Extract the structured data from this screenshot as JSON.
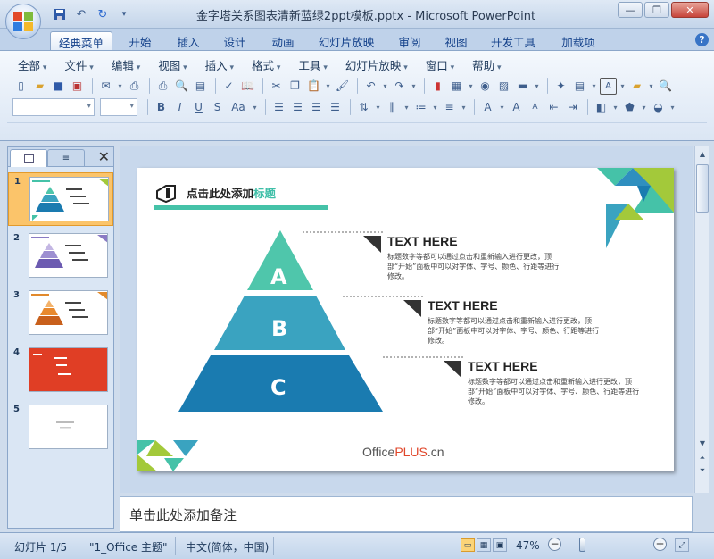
{
  "window": {
    "title": "金字塔关系图表清新蓝绿2ppt模板.pptx - Microsoft PowerPoint"
  },
  "tabs": [
    "经典菜单",
    "开始",
    "插入",
    "设计",
    "动画",
    "幻灯片放映",
    "审阅",
    "视图",
    "开发工具",
    "加载项"
  ],
  "menu": [
    "全部",
    "文件",
    "编辑",
    "视图",
    "插入",
    "格式",
    "工具",
    "幻灯片放映",
    "窗口",
    "帮助"
  ],
  "slides": [
    {
      "num": "1",
      "theme": "teal"
    },
    {
      "num": "2",
      "theme": "purple"
    },
    {
      "num": "3",
      "theme": "orange"
    },
    {
      "num": "4",
      "theme": "red"
    },
    {
      "num": "5",
      "theme": "blank"
    }
  ],
  "slide": {
    "title_main": "点击此处添加",
    "title_accent": "标题",
    "pyramid": [
      {
        "label": "A",
        "color": "#4fc6ab"
      },
      {
        "label": "B",
        "color": "#3aa3c0"
      },
      {
        "label": "C",
        "color": "#1a7bb0"
      }
    ],
    "items": [
      {
        "heading": "TEXT HERE",
        "body": "标题数字等都可以通过点击和重新输入进行更改，顶部“开始”面板中可以对字体、字号、颜色、行距等进行修改。"
      },
      {
        "heading": "TEXT HERE",
        "body": "标题数字等都可以通过点击和重新输入进行更改，顶部“开始”面板中可以对字体、字号、颜色、行距等进行修改。"
      },
      {
        "heading": "TEXT HERE",
        "body": "标题数字等都可以通过点击和重新输入进行更改，顶部“开始”面板中可以对字体、字号、颜色、行距等进行修改。"
      }
    ],
    "logo": {
      "part1": "Office",
      "part2": "PLUS",
      "part3": ".cn"
    }
  },
  "notes": {
    "placeholder": "单击此处添加备注"
  },
  "status": {
    "slide_pos": "幻灯片 1/5",
    "theme": "\"1_Office 主题\"",
    "language": "中文(简体，中国)",
    "zoom": "47%"
  },
  "colors": {
    "teal": "#45c2a8",
    "lime": "#a3c93a",
    "blue": "#1a7bb0"
  }
}
